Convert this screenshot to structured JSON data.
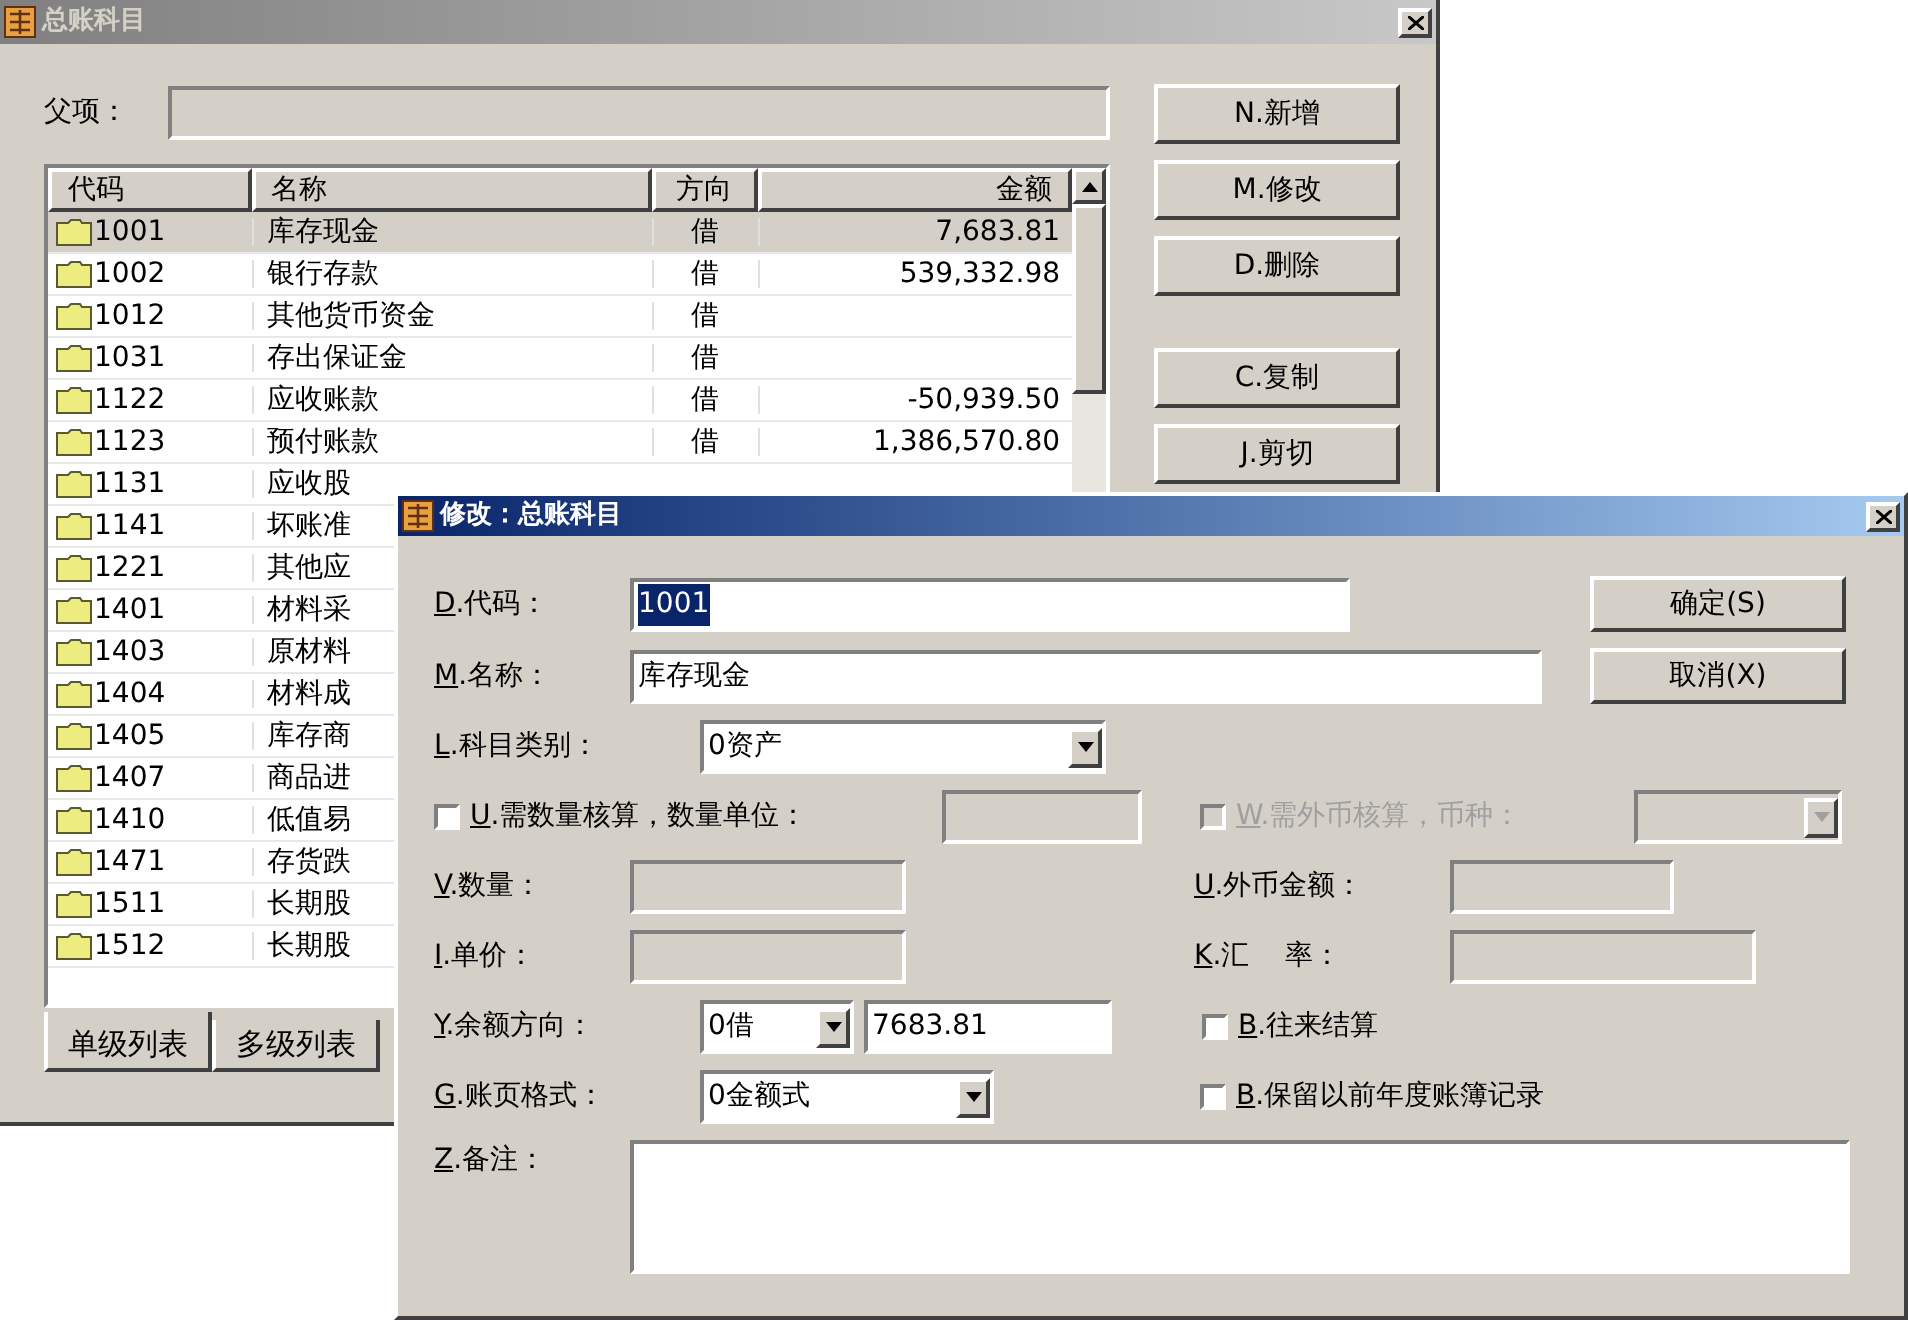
{
  "main_window": {
    "title": "总账科目",
    "parent_label": "父项：",
    "columns": [
      "代码",
      "名称",
      "方向",
      "金额"
    ],
    "rows": [
      {
        "code": "1001",
        "name": "库存现金",
        "direction": "借",
        "amount": "7,683.81",
        "selected": true
      },
      {
        "code": "1002",
        "name": "银行存款",
        "direction": "借",
        "amount": "539,332.98",
        "selected": false
      },
      {
        "code": "1012",
        "name": "其他货币资金",
        "direction": "借",
        "selected": false
      },
      {
        "code": "1031",
        "name": "存出保证金",
        "direction": "借",
        "selected": false
      },
      {
        "code": "1122",
        "name": "应收账款",
        "direction": "借",
        "amount": "-50,939.50",
        "selected": false
      },
      {
        "code": "1123",
        "name": "预付账款",
        "direction": "借",
        "amount": "1,386,570.80",
        "selected": false
      },
      {
        "code": "1131",
        "name": "应收股",
        "selected": false
      },
      {
        "code": "1141",
        "name": "坏账准",
        "selected": false
      },
      {
        "code": "1221",
        "name": "其他应",
        "selected": false
      },
      {
        "code": "1401",
        "name": "材料采",
        "selected": false
      },
      {
        "code": "1403",
        "name": "原材料",
        "selected": false
      },
      {
        "code": "1404",
        "name": "材料成",
        "selected": false
      },
      {
        "code": "1405",
        "name": "库存商",
        "selected": false
      },
      {
        "code": "1407",
        "name": "商品进",
        "selected": false
      },
      {
        "code": "1410",
        "name": "低值易",
        "selected": false
      },
      {
        "code": "1471",
        "name": "存货跌",
        "selected": false
      },
      {
        "code": "1511",
        "name": "长期股",
        "selected": false
      },
      {
        "code": "1512",
        "name": "长期股",
        "selected": false
      }
    ],
    "buttons": [
      "N.新增",
      "M.修改",
      "D.删除",
      "C.复制",
      "J.剪切"
    ],
    "tabs": [
      {
        "label": "单级列表",
        "selected": true
      },
      {
        "label": "多级列表",
        "selected": false
      }
    ]
  },
  "dialog": {
    "title": "修改：总账科目",
    "buttons": [
      "确定(S)",
      "取消(X)"
    ],
    "code": {
      "label": "D.代码：",
      "value": "1001"
    },
    "name": {
      "label": "M.名称：",
      "value": "库存现金"
    },
    "category": {
      "label": "L.科目类别：",
      "value": "0资产"
    },
    "quantity_check": {
      "label": "U.需数量核算，数量单位：",
      "checked": false,
      "disabled": false
    },
    "foreign_check": {
      "label": "W.需外币核算，币种：",
      "checked": false,
      "disabled": true
    },
    "quantity": {
      "label": "V.数量："
    },
    "foreign_amount": {
      "label": "U.外币金额："
    },
    "unit_price": {
      "label": "I.单价："
    },
    "rate": {
      "label": "K.汇    率："
    },
    "balance": {
      "label": "Y.余额方向：",
      "direction": "0借",
      "value": "7683.81"
    },
    "settlement": {
      "label": "B.往来结算",
      "checked": false,
      "disabled": false
    },
    "keep_history": {
      "label": "B.保留以前年度账簿记录",
      "checked": false,
      "disabled": false
    },
    "ledger_format": {
      "label": "G.账页格式：",
      "value": "0金额式"
    },
    "note": {
      "label": "Z.备注："
    }
  }
}
